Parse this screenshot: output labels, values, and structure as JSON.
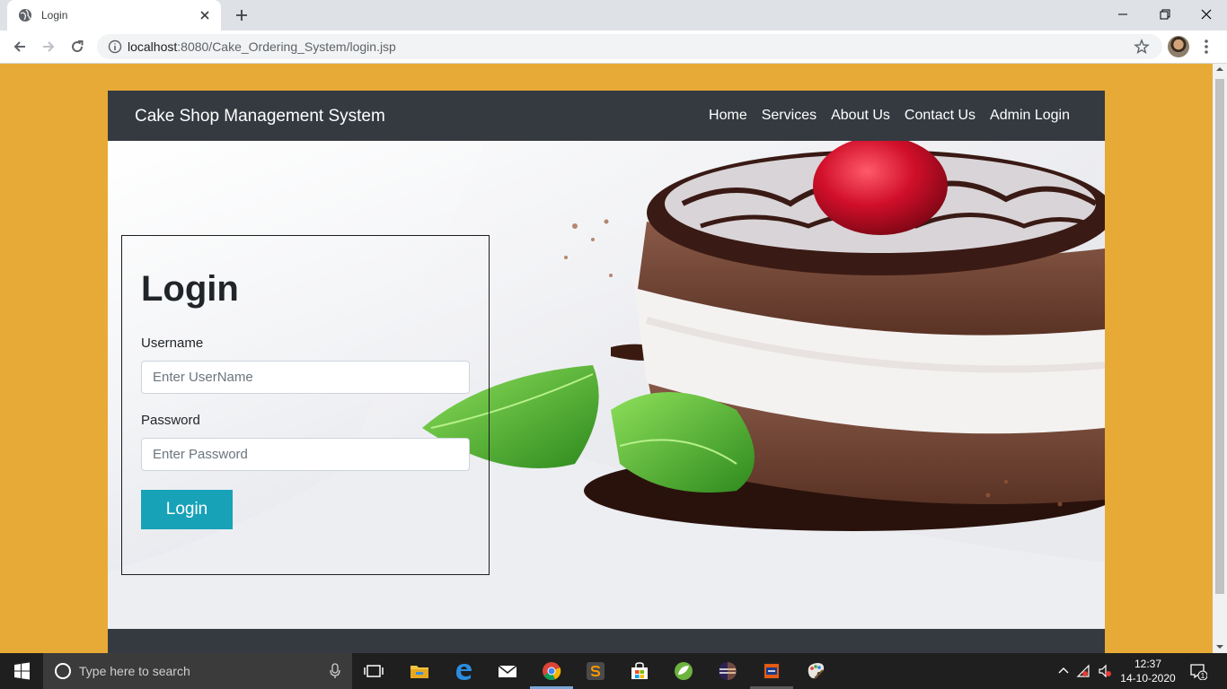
{
  "browser": {
    "tab_title": "Login",
    "url_host": "localhost",
    "url_rest": ":8080/Cake_Ordering_System/login.jsp"
  },
  "site": {
    "brand": "Cake Shop Management System",
    "nav": [
      {
        "label": "Home"
      },
      {
        "label": "Services"
      },
      {
        "label": "About Us"
      },
      {
        "label": "Contact Us"
      },
      {
        "label": "Admin Login"
      }
    ]
  },
  "login": {
    "title": "Login",
    "username_label": "Username",
    "username_placeholder": "Enter UserName",
    "password_label": "Password",
    "password_placeholder": "Enter Password",
    "button": "Login"
  },
  "taskbar": {
    "search_placeholder": "Type here to search",
    "time": "12:37",
    "date": "14-10-2020",
    "notifications": "1"
  },
  "colors": {
    "page_bg": "#e8aa37",
    "nav_bg": "#343a40",
    "button": "#17a2b8"
  }
}
